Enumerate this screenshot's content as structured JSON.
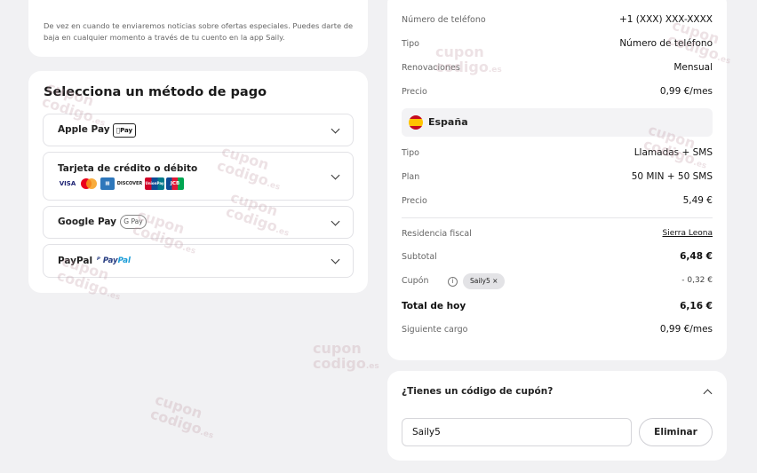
{
  "newsletter": {
    "text": "De vez en cuando te enviaremos noticias sobre ofertas especiales. Puedes darte de baja en cualquier momento a través de tu cuento en la app Saily."
  },
  "payment": {
    "title": "Selecciona un método de pago",
    "options": [
      {
        "label": "Apple Pay",
        "badge": "Pay"
      },
      {
        "label": "Tarjeta de crédito o débito",
        "cards": [
          "VISA",
          "MC",
          "AMEX",
          "DISCOVER",
          "UnionPay",
          "JCB"
        ]
      },
      {
        "label": "Google Pay",
        "badge": "G Pay"
      },
      {
        "label": "PayPal",
        "logo_a": "Pay",
        "logo_b": "Pal"
      }
    ]
  },
  "summary": {
    "phone_label": "Número de teléfono",
    "phone_value": "+1 (XXX) XXX-XXXX",
    "type1_label": "Tipo",
    "type1_value": "Número de teléfono",
    "renewal_label": "Renovaciones",
    "renewal_value": "Mensual",
    "price1_label": "Precio",
    "price1_value": "0,99 €/mes",
    "country": "España",
    "type2_label": "Tipo",
    "type2_value": "Llamadas + SMS",
    "plan_label": "Plan",
    "plan_value": "50 MIN + 50 SMS",
    "price2_label": "Precio",
    "price2_value": "5,49 €",
    "tax_label": "Residencia fiscal",
    "tax_value": "Sierra Leona",
    "subtotal_label": "Subtotal",
    "subtotal_value": "6,48 €",
    "coupon_label": "Cupón",
    "coupon_code": "Saily5 ×",
    "coupon_value": "- 0,32 €",
    "total_label": "Total de hoy",
    "total_value": "6,16 €",
    "next_label": "Siguiente cargo",
    "next_value": "0,99 €/mes"
  },
  "coupon": {
    "title": "¿Tienes un código de cupón?",
    "input_value": "Saily5",
    "remove_label": "Eliminar"
  },
  "watermark": {
    "line1": "cupon",
    "line2": "codigo",
    "suffix": ".es"
  },
  "colors": {
    "background": "#f1f1f3",
    "card": "#ffffff",
    "chip": "#e3e3e6"
  }
}
